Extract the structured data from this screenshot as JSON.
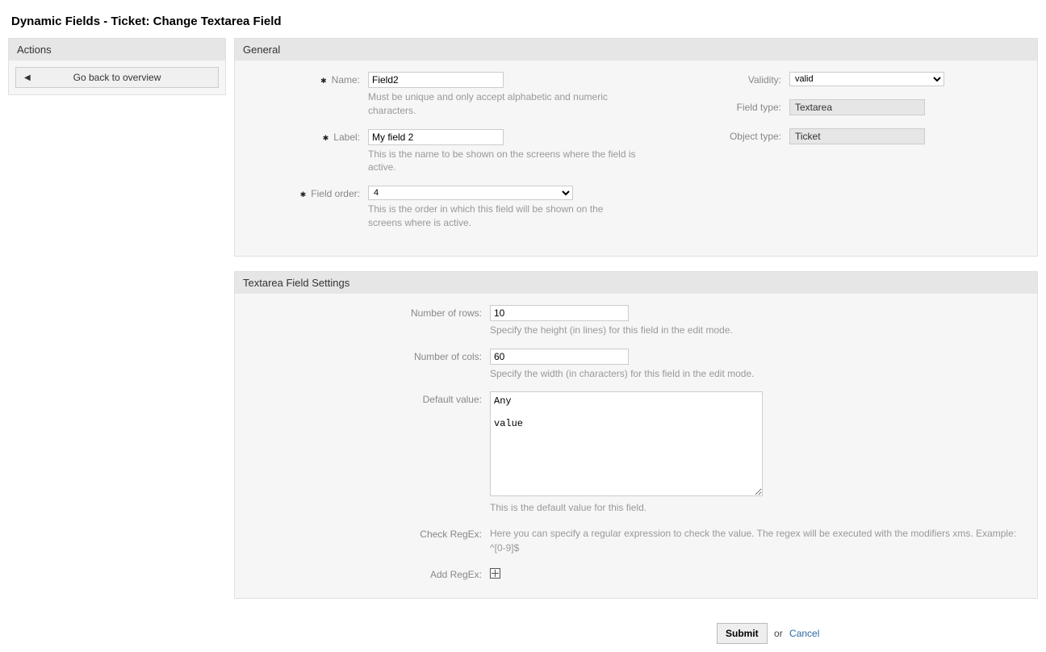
{
  "page_title": "Dynamic Fields - Ticket: Change Textarea Field",
  "sidebar": {
    "header": "Actions",
    "go_back": "Go back to overview"
  },
  "general": {
    "header": "General",
    "name_label": "Name:",
    "name_value": "Field2",
    "name_hint": "Must be unique and only accept alphabetic and numeric characters.",
    "label_label": "Label:",
    "label_value": "My field 2",
    "label_hint": "This is the name to be shown on the screens where the field is active.",
    "order_label": "Field order:",
    "order_value": "4",
    "order_hint": "This is the order in which this field will be shown on the screens where is active.",
    "validity_label": "Validity:",
    "validity_value": "valid",
    "fieldtype_label": "Field type:",
    "fieldtype_value": "Textarea",
    "objecttype_label": "Object type:",
    "objecttype_value": "Ticket"
  },
  "settings": {
    "header": "Textarea Field Settings",
    "rows_label": "Number of rows:",
    "rows_value": "10",
    "rows_hint": "Specify the height (in lines) for this field in the edit mode.",
    "cols_label": "Number of cols:",
    "cols_value": "60",
    "cols_hint": "Specify the width (in characters) for this field in the edit mode.",
    "default_label": "Default value:",
    "default_value": "Any\n\nvalue",
    "default_hint": "This is the default value for this field.",
    "checkregex_label": "Check RegEx:",
    "checkregex_hint": "Here you can specify a regular expression to check the value. The regex will be executed with the modifiers xms. Example: ^[0-9]$",
    "addregex_label": "Add RegEx:"
  },
  "footer": {
    "submit": "Submit",
    "or": "or",
    "cancel": "Cancel"
  }
}
